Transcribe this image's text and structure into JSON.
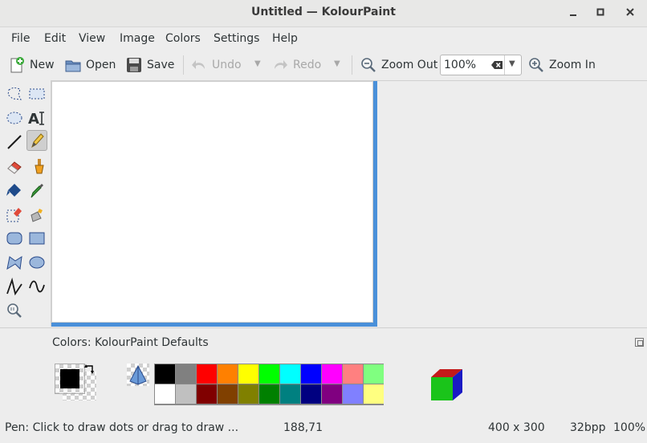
{
  "window": {
    "title": "Untitled — KolourPaint"
  },
  "menu": [
    "File",
    "Edit",
    "View",
    "Image",
    "Colors",
    "Settings",
    "Help"
  ],
  "toolbar": {
    "new_label": "New",
    "open_label": "Open",
    "save_label": "Save",
    "undo_label": "Undo",
    "redo_label": "Redo",
    "zoom_out_label": "Zoom Out",
    "zoom_value": "100%",
    "zoom_in_label": "Zoom In"
  },
  "tools": [
    "free-form-selection-icon",
    "rectangular-selection-icon",
    "elliptical-selection-icon",
    "text-icon",
    "line-icon",
    "pen-icon",
    "eraser-icon",
    "brush-icon",
    "flood-fill-icon",
    "color-picker-icon",
    "color-eraser-icon",
    "spraycan-icon",
    "rounded-rectangle-icon",
    "rectangle-icon",
    "polygon-icon",
    "ellipse-icon",
    "connected-lines-icon",
    "curve-icon",
    "zoom-icon"
  ],
  "selected_tool": "pen-icon",
  "colors_panel": {
    "title": "Colors: KolourPaint Defaults",
    "foreground": "#000000",
    "background": "transparent",
    "palette_top": [
      "#000000",
      "#808080",
      "#ff0000",
      "#ff8000",
      "#ffff00",
      "#00ff00",
      "#00ffff",
      "#0000ff",
      "#ff00ff",
      "#ff8080",
      "#80ff80"
    ],
    "palette_bottom": [
      "#ffffff",
      "#c0c0c0",
      "#800000",
      "#804000",
      "#808000",
      "#008000",
      "#008080",
      "#000080",
      "#800080",
      "#8080ff",
      "#ffff80"
    ]
  },
  "status": {
    "message": "Pen: Click to draw dots or drag to draw ...",
    "cursor": "188,71",
    "size": "400 x 300",
    "depth": "32bpp",
    "zoom": "100%"
  }
}
